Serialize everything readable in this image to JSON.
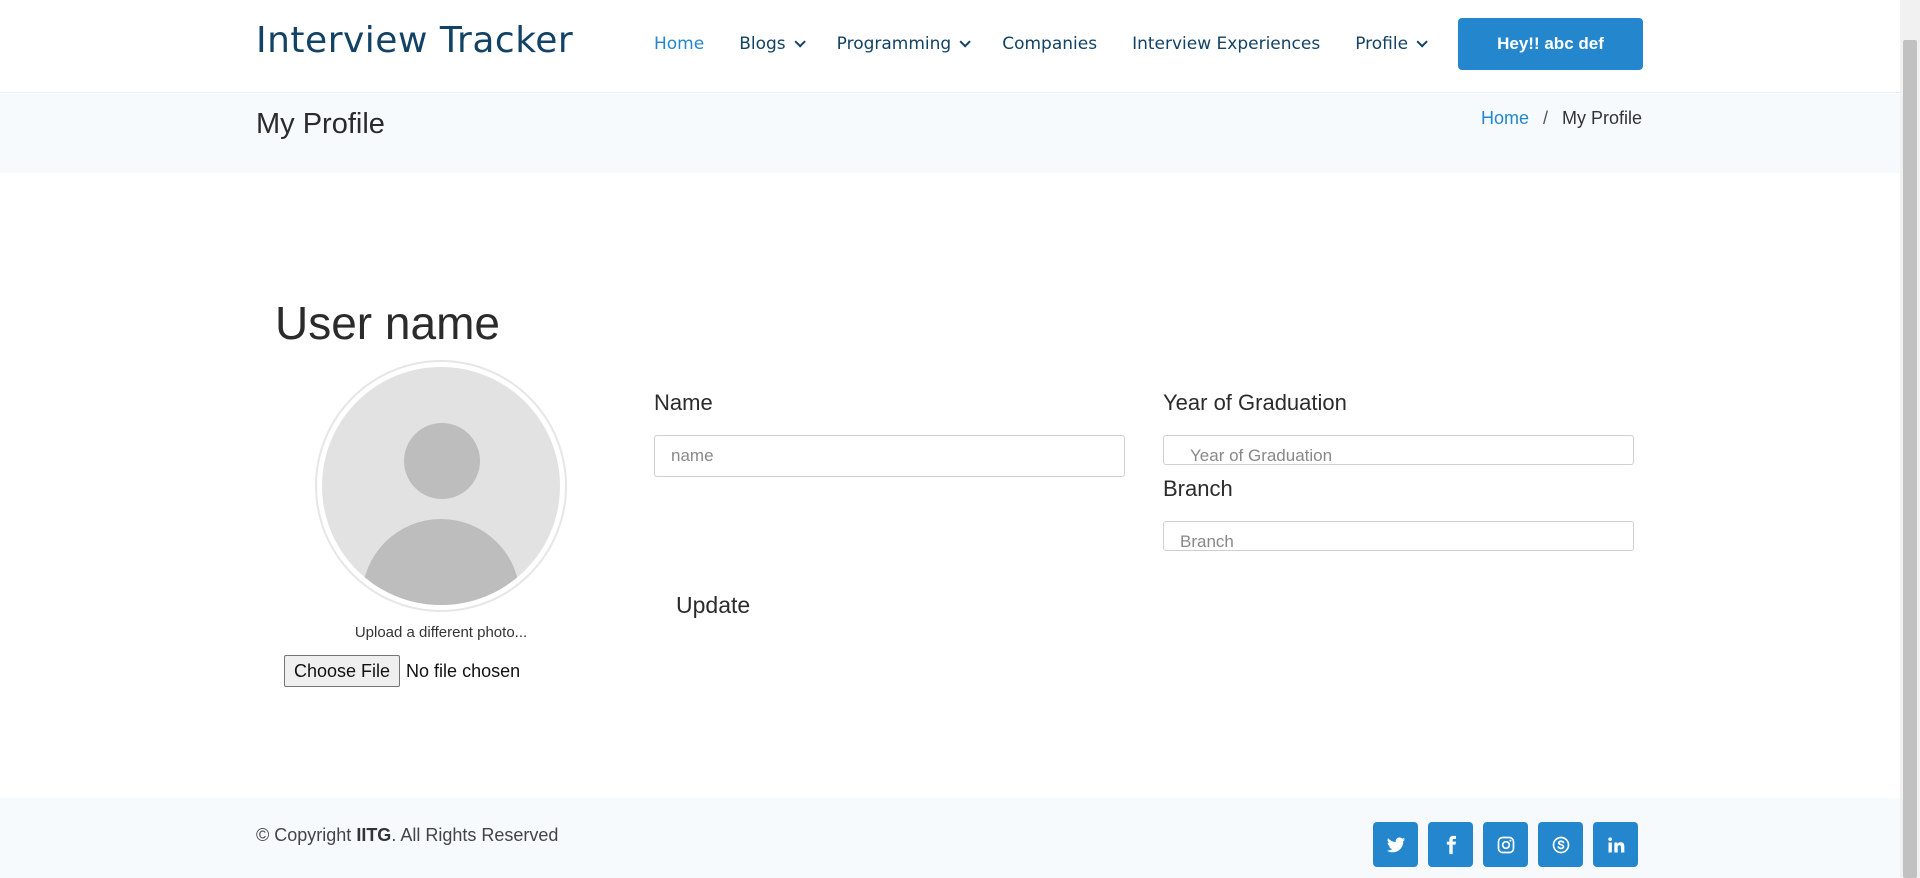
{
  "header": {
    "logo": "Interview Tracker",
    "nav": [
      {
        "label": "Home",
        "dropdown": false,
        "active": true
      },
      {
        "label": "Blogs",
        "dropdown": true
      },
      {
        "label": "Programming",
        "dropdown": true
      },
      {
        "label": "Companies",
        "dropdown": false
      },
      {
        "label": "Interview Experiences",
        "dropdown": false
      },
      {
        "label": "Profile",
        "dropdown": true
      }
    ],
    "cta_label": "Hey!! abc def"
  },
  "breadcrumb_band": {
    "page_title": "My Profile",
    "crumbs": {
      "home": "Home",
      "separator": "/",
      "current": "My Profile"
    }
  },
  "profile": {
    "username": "User name",
    "avatar_icon": "default-avatar-icon",
    "upload_hint": "Upload a different photo...",
    "file_button": "Choose File",
    "file_status": "No file chosen"
  },
  "form": {
    "name_label": "Name",
    "name_placeholder": "name",
    "year_label": "Year of Graduation",
    "year_placeholder": "Year of Graduation",
    "branch_label": "Branch",
    "branch_placeholder": "Branch",
    "update_label": "Update"
  },
  "footer": {
    "copyright_prefix": "© Copyright ",
    "copyright_org": "IITG",
    "copyright_suffix": ". All Rights Reserved",
    "socials": [
      "twitter-icon",
      "facebook-icon",
      "instagram-icon",
      "skype-icon",
      "linkedin-icon"
    ]
  },
  "colors": {
    "accent": "#2487ce",
    "brand_text": "#124265",
    "band_bg": "#f6fafd"
  }
}
